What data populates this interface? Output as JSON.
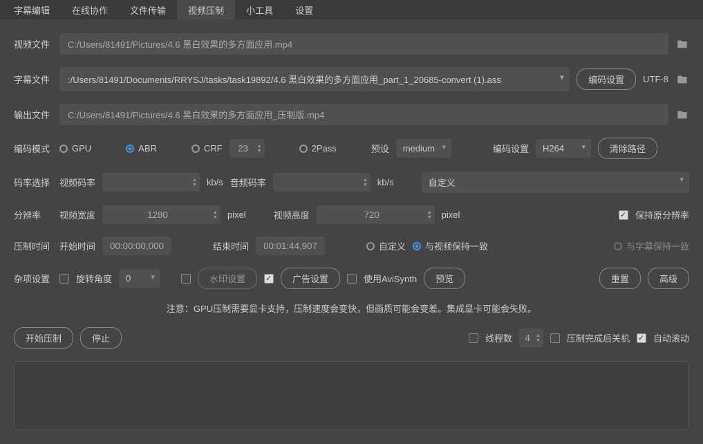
{
  "tabs": {
    "subtitle_edit": "字幕编辑",
    "online_collab": "在线协作",
    "file_transfer": "文件传输",
    "video_compress": "视频压制",
    "tools": "小工具",
    "settings": "设置"
  },
  "labels": {
    "video_file": "视频文件",
    "subtitle_file": "字幕文件",
    "output_file": "输出文件",
    "encode_mode": "编码模式",
    "bitrate_select": "码率选择",
    "resolution": "分辨率",
    "compress_time": "压制时间",
    "misc": "杂项设置",
    "video_bitrate": "视频码率",
    "audio_bitrate": "音频码率",
    "video_width": "视频宽度",
    "video_height": "视频高度",
    "start_time": "开始时间",
    "end_time": "结束时间",
    "preset": "预设",
    "encode_setting": "编码设置",
    "rotate_angle": "旋转角度",
    "watermark": "水印设置",
    "ad_setting": "广告设置",
    "use_avisynth": "使用AviSynth",
    "threads": "线程数",
    "shutdown_after": "压制完成后关机",
    "auto_scroll": "自动滚动",
    "keep_resolution": "保持原分辨率",
    "custom": "自定义",
    "sync_video": "与视频保持一致",
    "sync_subtitle": "与字幕保持一致"
  },
  "values": {
    "video_path": "C:/Users/81491/Pictures/4.6 黑白效果的多方面应用.mp4",
    "subtitle_path": ":/Users/81491/Documents/RRYSJ/tasks/task19892/4.6 黑白效果的多方面应用_part_1_20685-convert (1).ass",
    "output_path": "C:/Users/81491/Pictures/4.6 黑白效果的多方面应用_压制版.mp4",
    "crf": "23",
    "video_bitrate": "",
    "audio_bitrate": "",
    "bitrate_preset": "自定义",
    "width": "1280",
    "height": "720",
    "start_time": "00:00:00,000",
    "end_time": "00:01:44,907",
    "preset": "medium",
    "codec": "H264",
    "encoding_charset": "UTF-8",
    "rotate": "0",
    "threads": "4"
  },
  "radios": {
    "gpu": "GPU",
    "abr": "ABR",
    "crf": "CRF",
    "twopass": "2Pass"
  },
  "buttons": {
    "encoding_setting": "编码设置",
    "clear_path": "清除路径",
    "preview": "预览",
    "reset": "重置",
    "advanced": "高级",
    "start": "开始压制",
    "stop": "停止"
  },
  "notice": "注意：GPU压制需要显卡支持，压制速度会变快，但画质可能会变差。集成显卡可能会失败。",
  "units": {
    "kbps": "kb/s",
    "pixel": "pixel"
  }
}
